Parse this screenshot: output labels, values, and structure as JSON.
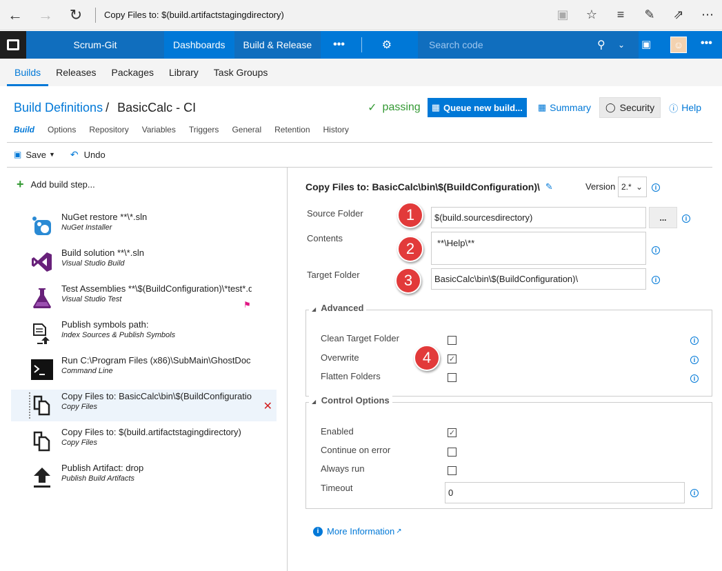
{
  "browser": {
    "address": "Copy Files to: $(build.artifactstagingdirectory)"
  },
  "topbar": {
    "project": "Scrum-Git",
    "hubs": [
      "Dashboards",
      "Build & Release",
      "•••"
    ],
    "search_placeholder": "Search code"
  },
  "subnav": {
    "items": [
      "Builds",
      "Releases",
      "Packages",
      "Library",
      "Task Groups"
    ]
  },
  "titlebar": {
    "breadcrumb_link": "Build Definitions",
    "separator": "/",
    "definition_name": "BasicCalc - CI",
    "status": "passing",
    "queue_button": "Queue new build...",
    "summary": "Summary",
    "security": "Security",
    "help": "Help"
  },
  "tabs": [
    "Build",
    "Options",
    "Repository",
    "Variables",
    "Triggers",
    "General",
    "Retention",
    "History"
  ],
  "toolbar": {
    "save": "Save",
    "undo": "Undo"
  },
  "left": {
    "add_step": "Add build step...",
    "steps": [
      {
        "name": "NuGet restore **\\*.sln",
        "type": "NuGet Installer"
      },
      {
        "name": "Build solution **\\*.sln",
        "type": "Visual Studio Build"
      },
      {
        "name": "Test Assemblies **\\$(BuildConfiguration)\\*test*.dll",
        "type": "Visual Studio Test"
      },
      {
        "name": "Publish symbols path:",
        "type": "Index Sources & Publish Symbols"
      },
      {
        "name": "Run C:\\Program Files (x86)\\SubMain\\GhostDoc",
        "type": "Command Line"
      },
      {
        "name": "Copy Files to: BasicCalc\\bin\\$(BuildConfiguration)\\",
        "type": "Copy Files"
      },
      {
        "name": "Copy Files to: $(build.artifactstagingdirectory)",
        "type": "Copy Files"
      },
      {
        "name": "Publish Artifact: drop",
        "type": "Publish Build Artifacts"
      }
    ]
  },
  "task": {
    "title": "Copy Files to: BasicCalc\\bin\\$(BuildConfiguration)\\",
    "version_label": "Version",
    "version_value": "2.*",
    "source_folder_label": "Source Folder",
    "source_folder_value": "$(build.sourcesdirectory)",
    "browse": "...",
    "contents_label": "Contents",
    "contents_value": "**\\Help\\**",
    "target_folder_label": "Target Folder",
    "target_folder_value": "BasicCalc\\bin\\$(BuildConfiguration)\\",
    "badges": [
      "1",
      "2",
      "3",
      "4"
    ],
    "advanced": {
      "heading": "Advanced",
      "clean_target": "Clean Target Folder",
      "overwrite": "Overwrite",
      "flatten": "Flatten Folders",
      "overwrite_checked": true
    },
    "control": {
      "heading": "Control Options",
      "enabled": "Enabled",
      "continue_on_error": "Continue on error",
      "always_run": "Always run",
      "timeout": "Timeout",
      "timeout_value": "0",
      "enabled_checked": true
    },
    "more_info": "More Information"
  }
}
